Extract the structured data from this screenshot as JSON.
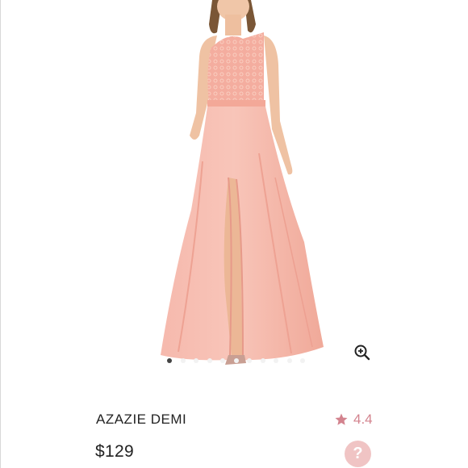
{
  "product": {
    "brand_name": "AZAZIE DEMI",
    "price": "$129",
    "rating": "4.4",
    "image_alt": "Coral pink one-shoulder lace-bodice chiffon floor-length gown with front slit"
  },
  "carousel": {
    "total": 11,
    "active_index": 0
  },
  "icons": {
    "zoom": "zoom-in-icon",
    "rating": "star-icon",
    "help": "question-icon"
  },
  "help_label": "?",
  "colors": {
    "accent": "#d3838e",
    "dress": "#f5b4a8",
    "help_bg": "#f0c4c4"
  }
}
